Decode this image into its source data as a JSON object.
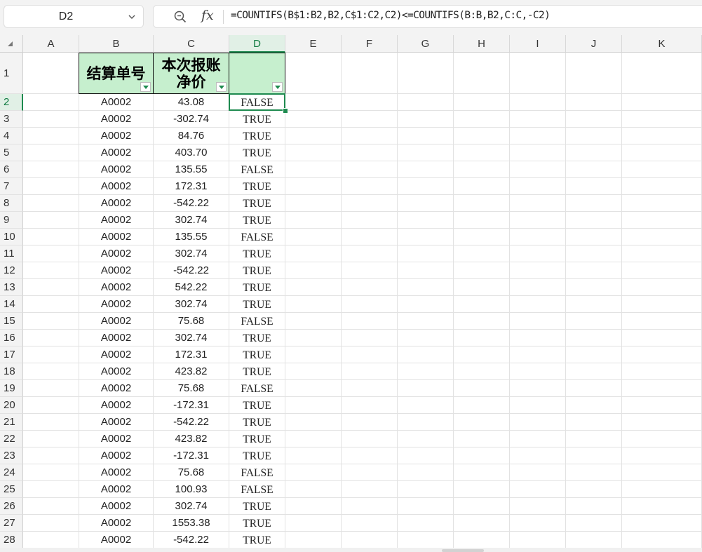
{
  "formula_bar": {
    "name_box": "D2",
    "fx_label": "fx",
    "formula": "=COUNTIFS(B$1:B2,B2,C$1:C2,C2)<=COUNTIFS(B:B,B2,C:C,-C2)"
  },
  "columns": [
    "A",
    "B",
    "C",
    "D",
    "E",
    "F",
    "G",
    "H",
    "I",
    "J",
    "K"
  ],
  "active_column": "D",
  "active_row": 2,
  "header_row": {
    "row_number": "1",
    "B": "结算单号",
    "C_line1": "本次报账",
    "C_line2": "净价",
    "D": ""
  },
  "rows": [
    {
      "n": "2",
      "b": "A0002",
      "c": "43.08",
      "d": "FALSE"
    },
    {
      "n": "3",
      "b": "A0002",
      "c": "-302.74",
      "d": "TRUE"
    },
    {
      "n": "4",
      "b": "A0002",
      "c": "84.76",
      "d": "TRUE"
    },
    {
      "n": "5",
      "b": "A0002",
      "c": "403.70",
      "d": "TRUE"
    },
    {
      "n": "6",
      "b": "A0002",
      "c": "135.55",
      "d": "FALSE"
    },
    {
      "n": "7",
      "b": "A0002",
      "c": "172.31",
      "d": "TRUE"
    },
    {
      "n": "8",
      "b": "A0002",
      "c": "-542.22",
      "d": "TRUE"
    },
    {
      "n": "9",
      "b": "A0002",
      "c": "302.74",
      "d": "TRUE"
    },
    {
      "n": "10",
      "b": "A0002",
      "c": "135.55",
      "d": "FALSE"
    },
    {
      "n": "11",
      "b": "A0002",
      "c": "302.74",
      "d": "TRUE"
    },
    {
      "n": "12",
      "b": "A0002",
      "c": "-542.22",
      "d": "TRUE"
    },
    {
      "n": "13",
      "b": "A0002",
      "c": "542.22",
      "d": "TRUE"
    },
    {
      "n": "14",
      "b": "A0002",
      "c": "302.74",
      "d": "TRUE"
    },
    {
      "n": "15",
      "b": "A0002",
      "c": "75.68",
      "d": "FALSE"
    },
    {
      "n": "16",
      "b": "A0002",
      "c": "302.74",
      "d": "TRUE"
    },
    {
      "n": "17",
      "b": "A0002",
      "c": "172.31",
      "d": "TRUE"
    },
    {
      "n": "18",
      "b": "A0002",
      "c": "423.82",
      "d": "TRUE"
    },
    {
      "n": "19",
      "b": "A0002",
      "c": "75.68",
      "d": "FALSE"
    },
    {
      "n": "20",
      "b": "A0002",
      "c": "-172.31",
      "d": "TRUE"
    },
    {
      "n": "21",
      "b": "A0002",
      "c": "-542.22",
      "d": "TRUE"
    },
    {
      "n": "22",
      "b": "A0002",
      "c": "423.82",
      "d": "TRUE"
    },
    {
      "n": "23",
      "b": "A0002",
      "c": "-172.31",
      "d": "TRUE"
    },
    {
      "n": "24",
      "b": "A0002",
      "c": "75.68",
      "d": "FALSE"
    },
    {
      "n": "25",
      "b": "A0002",
      "c": "100.93",
      "d": "FALSE"
    },
    {
      "n": "26",
      "b": "A0002",
      "c": "302.74",
      "d": "TRUE"
    },
    {
      "n": "27",
      "b": "A0002",
      "c": "1553.38",
      "d": "TRUE"
    },
    {
      "n": "28",
      "b": "A0002",
      "c": "-542.22",
      "d": "TRUE"
    }
  ],
  "colors": {
    "header_fill": "#c6efce",
    "accent": "#1e8a4f"
  },
  "icons": {
    "zoom": "zoom-formula-icon",
    "dropdown": "chevron-down-icon",
    "filter": "filter-dropdown-icon"
  }
}
